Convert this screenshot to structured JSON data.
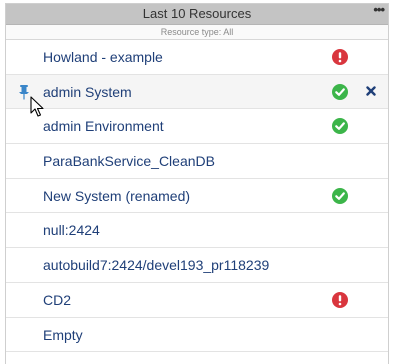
{
  "header": {
    "title": "Last 10 Resources",
    "more_label": "•••"
  },
  "subheader": {
    "text": "Resource type: All"
  },
  "rows": [
    {
      "label": "Howland - example",
      "status": "error"
    },
    {
      "label": "admin System",
      "status": "ok",
      "pinned": true,
      "removable": true
    },
    {
      "label": "admin Environment",
      "status": "ok"
    },
    {
      "label": "ParaBankService_CleanDB",
      "status": "none"
    },
    {
      "label": "New System (renamed)",
      "status": "ok"
    },
    {
      "label": "null:2424",
      "status": "none"
    },
    {
      "label": "autobuild7:2424/devel193_pr118239",
      "status": "none"
    },
    {
      "label": "CD2",
      "status": "error"
    },
    {
      "label": "Empty",
      "status": "none"
    }
  ],
  "icons": {
    "ok": "check-circle-icon",
    "error": "exclamation-circle-icon",
    "pin": "pin-icon",
    "remove": "close-icon"
  },
  "colors": {
    "ok": "#3cb54a",
    "error": "#d9363e",
    "link": "#1f3f78",
    "header_bg": "#c4c4c4"
  }
}
